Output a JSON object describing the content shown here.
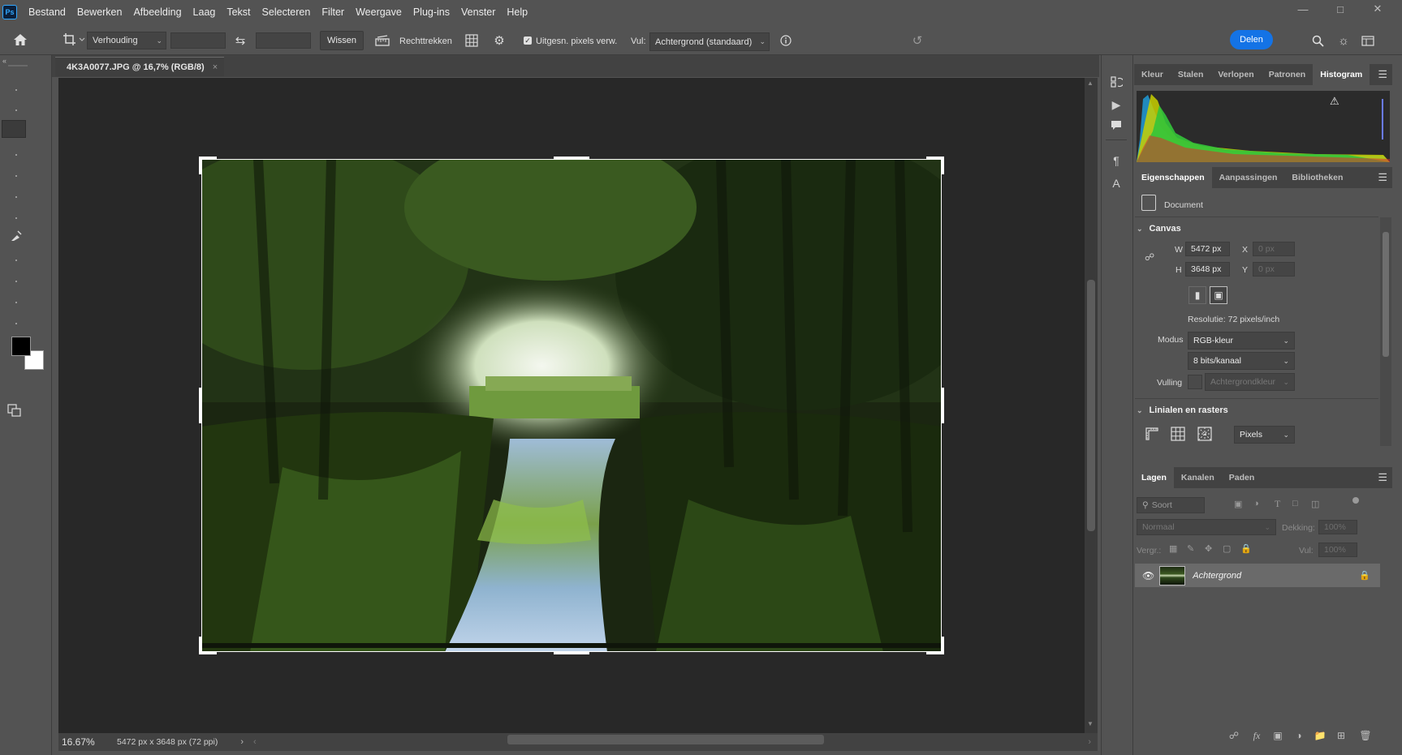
{
  "app": {
    "logo": "Ps"
  },
  "menu": [
    "Bestand",
    "Bewerken",
    "Afbeelding",
    "Laag",
    "Tekst",
    "Selecteren",
    "Filter",
    "Weergave",
    "Plug-ins",
    "Venster",
    "Help"
  ],
  "options": {
    "ratio_select": "Verhouding",
    "clear_button": "Wissen",
    "straighten_label": "Rechttrekken",
    "delete_cropped_label": "Uitgesn. pixels verw.",
    "fill_label": "Vul:",
    "fill_select": "Achtergrond (standaard)",
    "share_button": "Delen"
  },
  "document": {
    "tab_title": "4K3A0077.JPG @ 16,7% (RGB/8)",
    "zoom": "16.67%",
    "info": "5472 px x 3648 px (72 ppi)"
  },
  "panels": {
    "top_tabs": [
      "Kleur",
      "Stalen",
      "Verlopen",
      "Patronen",
      "Histogram"
    ],
    "top_active": "Histogram",
    "mid_tabs": [
      "Eigenschappen",
      "Aanpassingen",
      "Bibliotheken"
    ],
    "mid_active": "Eigenschappen",
    "bottom_tabs": [
      "Lagen",
      "Kanalen",
      "Paden"
    ],
    "bottom_active": "Lagen"
  },
  "properties": {
    "doc_label": "Document",
    "canvas_section": "Canvas",
    "w_label": "W",
    "w_value": "5472 px",
    "h_label": "H",
    "h_value": "3648 px",
    "x_label": "X",
    "x_value": "0 px",
    "y_label": "Y",
    "y_value": "0 px",
    "resolution": "Resolutie: 72 pixels/inch",
    "mode_label": "Modus",
    "mode_value": "RGB-kleur",
    "bits_value": "8 bits/kanaal",
    "fill_label": "Vulling",
    "fill_value": "Achtergrondkleur",
    "rulers_section": "Linialen en rasters",
    "units_value": "Pixels"
  },
  "layers": {
    "search_placeholder": "Soort",
    "blend_mode": "Normaal",
    "opacity_label": "Dekking:",
    "opacity_value": "100%",
    "lock_label": "Vergr.:",
    "fill_label": "Vul:",
    "fill_value": "100%",
    "items": [
      {
        "name": "Achtergrond",
        "visible": true,
        "locked": true
      }
    ]
  },
  "colors": {
    "accent": "#1473e6",
    "foreground": "#000000",
    "background": "#ffffff"
  }
}
